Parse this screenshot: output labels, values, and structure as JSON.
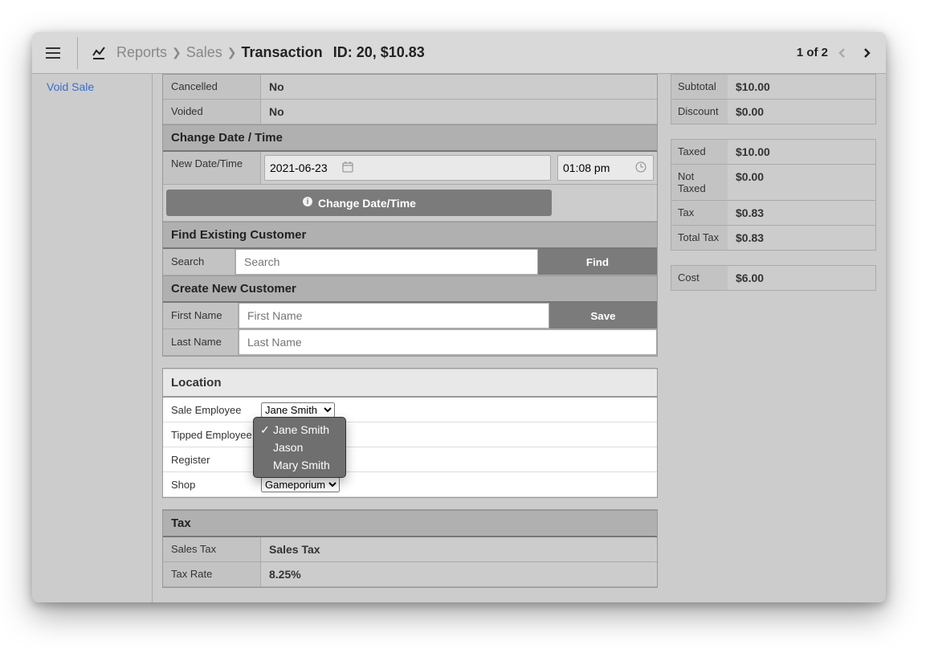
{
  "breadcrumb": {
    "item1": "Reports",
    "item2": "Sales",
    "current": "Transaction⠀ID: 20, $10.83"
  },
  "pager": {
    "text": "1 of 2"
  },
  "sidebar": {
    "void_sale": "Void Sale"
  },
  "status": {
    "cancelled_label": "Cancelled",
    "cancelled_value": "No",
    "voided_label": "Voided",
    "voided_value": "No"
  },
  "change_datetime": {
    "header": "Change Date / Time",
    "new_label": "New Date/Time",
    "date_value": "2021-06-23",
    "time_value": "01:08 pm",
    "button": "Change Date/Time"
  },
  "find_customer": {
    "header": "Find Existing Customer",
    "search_label": "Search",
    "search_placeholder": "Search",
    "find_button": "Find"
  },
  "create_customer": {
    "header": "Create New Customer",
    "first_label": "First Name",
    "first_placeholder": "First Name",
    "last_label": "Last Name",
    "last_placeholder": "Last Name",
    "save_button": "Save"
  },
  "location": {
    "header": "Location",
    "sale_emp_label": "Sale Employee",
    "sale_emp_selected": "Jane Smith",
    "tipped_emp_label": "Tipped Employee",
    "register_label": "Register",
    "shop_label": "Shop",
    "shop_selected": "Gameporium",
    "dropdown": {
      "opt1": "Jane Smith",
      "opt2": "Jason",
      "opt3": "Mary Smith"
    }
  },
  "tax": {
    "header": "Tax",
    "sales_tax_label": "Sales Tax",
    "sales_tax_value": "Sales Tax",
    "rate_label": "Tax Rate",
    "rate_value": "8.25%"
  },
  "summary": {
    "subtotal_label": "Subtotal",
    "subtotal_value": "$10.00",
    "discount_label": "Discount",
    "discount_value": "$0.00",
    "taxed_label": "Taxed",
    "taxed_value": "$10.00",
    "not_taxed_label": "Not Taxed",
    "not_taxed_value": "$0.00",
    "tax_label": "Tax",
    "tax_value": "$0.83",
    "total_tax_label": "Total Tax",
    "total_tax_value": "$0.83",
    "cost_label": "Cost",
    "cost_value": "$6.00"
  }
}
